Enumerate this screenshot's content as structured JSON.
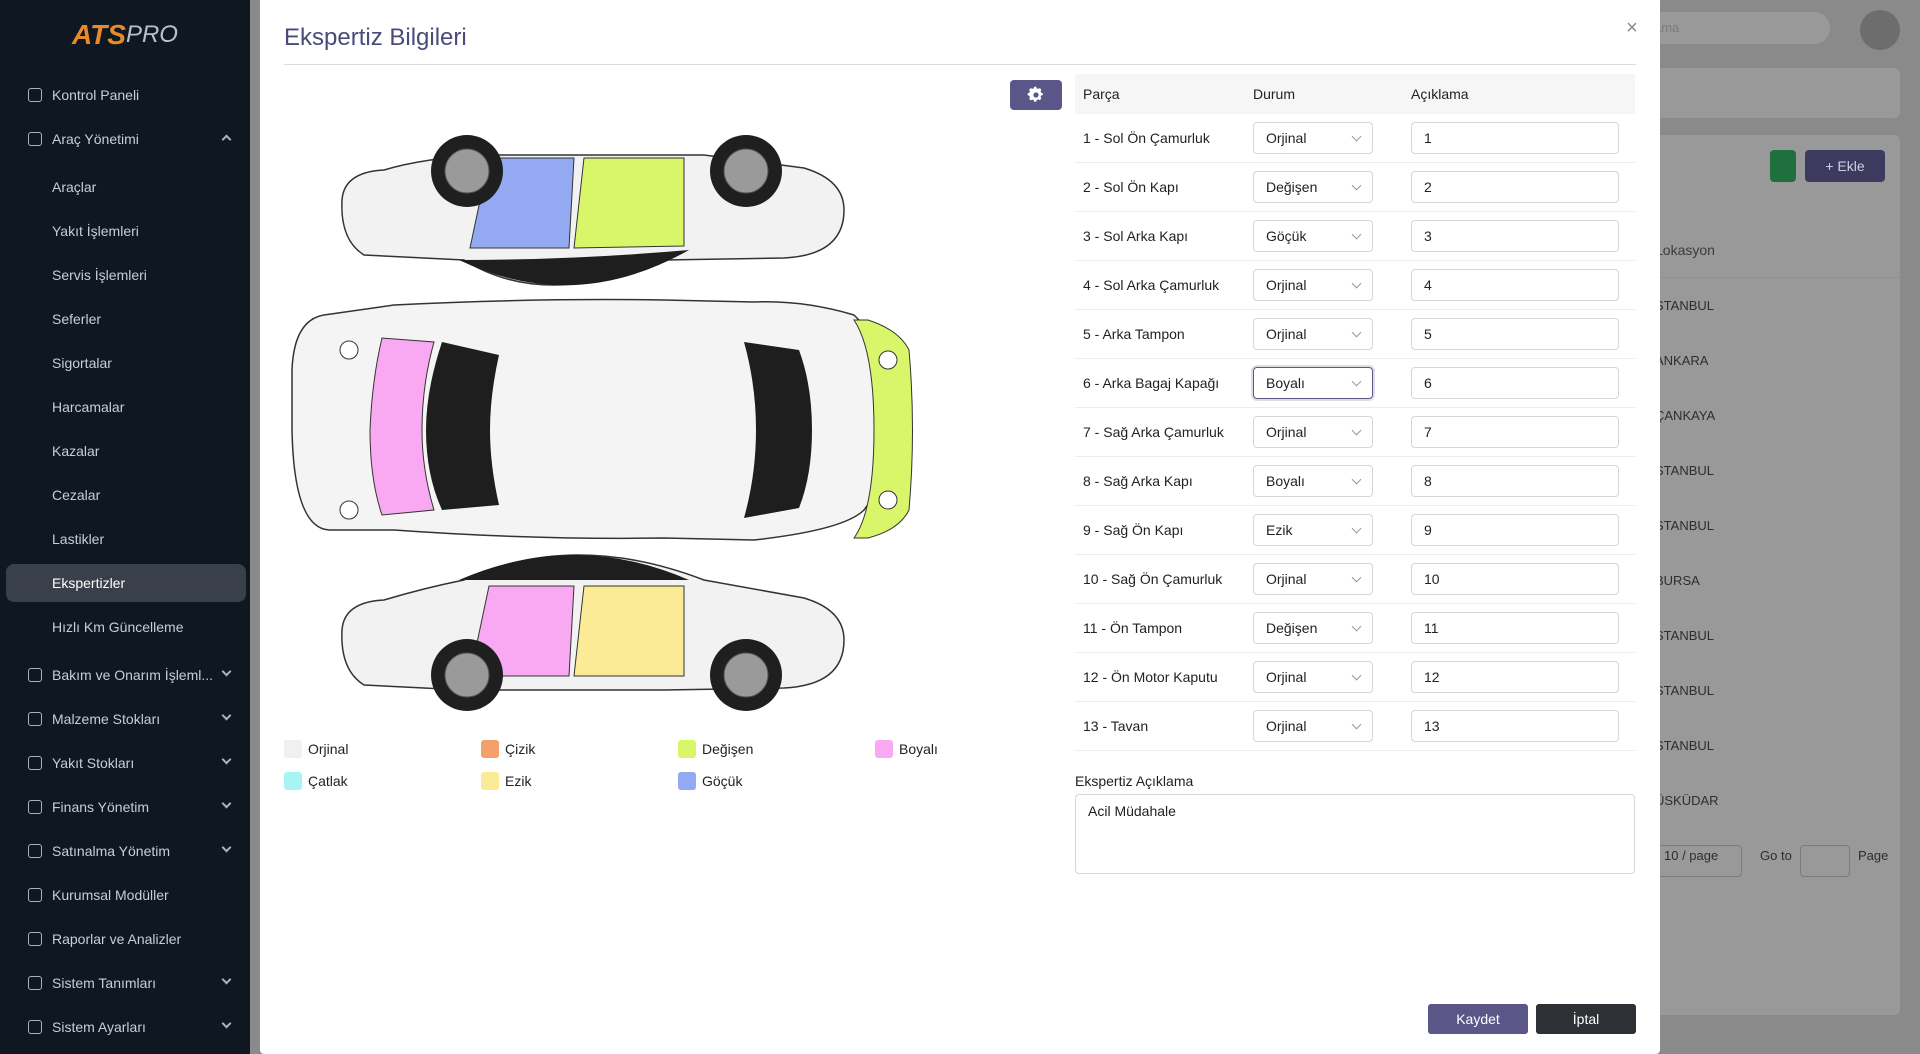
{
  "app": {
    "logo_primary": "ATS",
    "logo_secondary": "PRO"
  },
  "sidebar": {
    "items": [
      {
        "label": "Kontrol Paneli"
      },
      {
        "label": "Araç Yönetimi"
      },
      {
        "label": "Araçlar"
      },
      {
        "label": "Yakıt İşlemleri"
      },
      {
        "label": "Servis İşlemleri"
      },
      {
        "label": "Seferler"
      },
      {
        "label": "Sigortalar"
      },
      {
        "label": "Harcamalar"
      },
      {
        "label": "Kazalar"
      },
      {
        "label": "Cezalar"
      },
      {
        "label": "Lastikler"
      },
      {
        "label": "Ekspertizler"
      },
      {
        "label": "Hızlı Km Güncelleme"
      },
      {
        "label": "Bakım ve Onarım İşleml..."
      },
      {
        "label": "Malzeme Stokları"
      },
      {
        "label": "Yakıt Stokları"
      },
      {
        "label": "Finans Yönetim"
      },
      {
        "label": "Satınalma Yönetim"
      },
      {
        "label": "Kurumsal Modüller"
      },
      {
        "label": "Raporlar ve Analizler"
      },
      {
        "label": "Sistem Tanımları"
      },
      {
        "label": "Sistem Ayarları"
      }
    ]
  },
  "background": {
    "search_placeholder": "ama",
    "add_label": "Ekle",
    "column_header": "Lokasyon",
    "rows": [
      "STANBUL",
      "ANKARA",
      "ÇANKAYA",
      "STANBUL",
      "STANBUL",
      "BURSA",
      "STANBUL",
      "STANBUL",
      "STANBUL",
      "ÜSKÜDAR"
    ],
    "page_size": "10 / page",
    "goto_label": "Go to",
    "page_label": "Page"
  },
  "modal": {
    "title": "Ekspertiz Bilgileri",
    "close": "×",
    "columns": {
      "part": "Parça",
      "status": "Durum",
      "note": "Açıklama"
    },
    "rows": [
      {
        "part": "1 - Sol Ön Çamurluk",
        "status": "Orjinal",
        "note": "1"
      },
      {
        "part": "2 - Sol Ön Kapı",
        "status": "Değişen",
        "note": "2"
      },
      {
        "part": "3 - Sol Arka Kapı",
        "status": "Göçük",
        "note": "3"
      },
      {
        "part": "4 - Sol Arka Çamurluk",
        "status": "Orjinal",
        "note": "4"
      },
      {
        "part": "5 - Arka Tampon",
        "status": "Orjinal",
        "note": "5"
      },
      {
        "part": "6 - Arka Bagaj Kapağı",
        "status": "Boyalı",
        "note": "6"
      },
      {
        "part": "7 - Sağ Arka Çamurluk",
        "status": "Orjinal",
        "note": "7"
      },
      {
        "part": "8 - Sağ Arka Kapı",
        "status": "Boyalı",
        "note": "8"
      },
      {
        "part": "9 - Sağ Ön Kapı",
        "status": "Ezik",
        "note": "9"
      },
      {
        "part": "10 - Sağ Ön Çamurluk",
        "status": "Orjinal",
        "note": "10"
      },
      {
        "part": "11 - Ön Tampon",
        "status": "Değişen",
        "note": "11"
      },
      {
        "part": "12 - Ön Motor Kaputu",
        "status": "Orjinal",
        "note": "12"
      },
      {
        "part": "13 - Tavan",
        "status": "Orjinal",
        "note": "13"
      }
    ],
    "description_label": "Ekspertiz Açıklama",
    "description_value": "Acil Müdahale",
    "save_label": "Kaydet",
    "cancel_label": "İptal",
    "legend": [
      {
        "label": "Orjinal",
        "color": "#f0f0f0"
      },
      {
        "label": "Çizik",
        "color": "#f4a06b"
      },
      {
        "label": "Değişen",
        "color": "#d9f56a"
      },
      {
        "label": "Boyalı",
        "color": "#f9a8f2"
      },
      {
        "label": "Çatlak",
        "color": "#a6f4f4"
      },
      {
        "label": "Ezik",
        "color": "#fbea96"
      },
      {
        "label": "Göçük",
        "color": "#93a9f2"
      }
    ]
  }
}
